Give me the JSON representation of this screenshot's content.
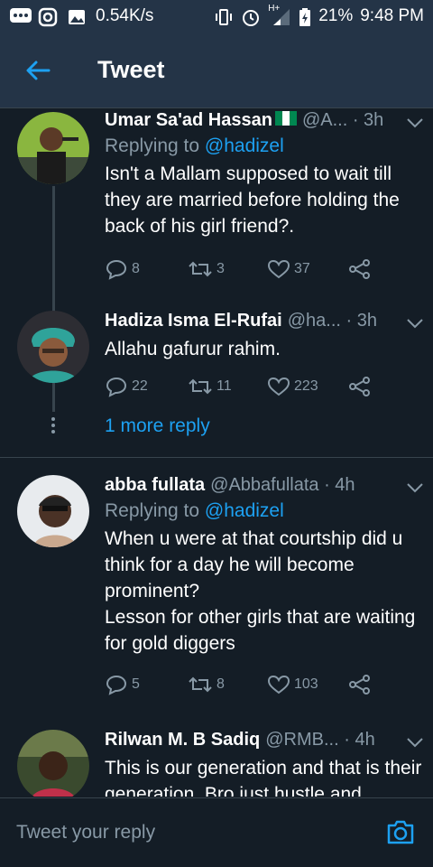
{
  "status": {
    "network_speed": "0.54K/s",
    "network_type": "H+",
    "battery": "21%",
    "time": "9:48 PM",
    "icons": [
      "message-icon",
      "instagram-icon",
      "gallery-icon",
      "vibrate-icon",
      "alarm-icon",
      "signal-icon",
      "battery-icon"
    ]
  },
  "header": {
    "title": "Tweet",
    "back_icon": "back-arrow-icon"
  },
  "tweets": [
    {
      "name": "Umar Sa'ad Hassan",
      "flag": "nigeria-flag-icon",
      "handle": "@A... · 3h",
      "replying_prefix": "Replying to ",
      "replying_to": "@hadizel",
      "text": "Isn't a Mallam supposed to wait till they are married before holding the back of his girl friend?.",
      "replies": "8",
      "retweets": "3",
      "likes": "37"
    },
    {
      "name": "Hadiza Isma El-Rufai",
      "handle": "@ha... · 3h",
      "text": "Allahu gafurur rahim.",
      "replies": "22",
      "retweets": "11",
      "likes": "223"
    },
    {
      "name": "abba fullata",
      "handle": "@Abbafullata · 4h",
      "replying_prefix": "Replying to ",
      "replying_to": "@hadizel",
      "text": "When u were at that courtship did u think for a day he will become prominent?",
      "text2": "Lesson for other girls that are waiting for gold diggers",
      "replies": "5",
      "retweets": "8",
      "likes": "103"
    },
    {
      "name": "Rilwan M. B Sadiq",
      "handle": "@RMB...  · 4h",
      "text": "This is our generation and that is their generation. Bro just hustle and"
    }
  ],
  "more_reply": "1 more reply",
  "reply_bar": {
    "placeholder": "Tweet your reply",
    "camera_icon": "camera-icon"
  },
  "colors": {
    "background": "#141d26",
    "header": "#243447",
    "accent": "#1da1f2",
    "muted": "#8899a6"
  }
}
